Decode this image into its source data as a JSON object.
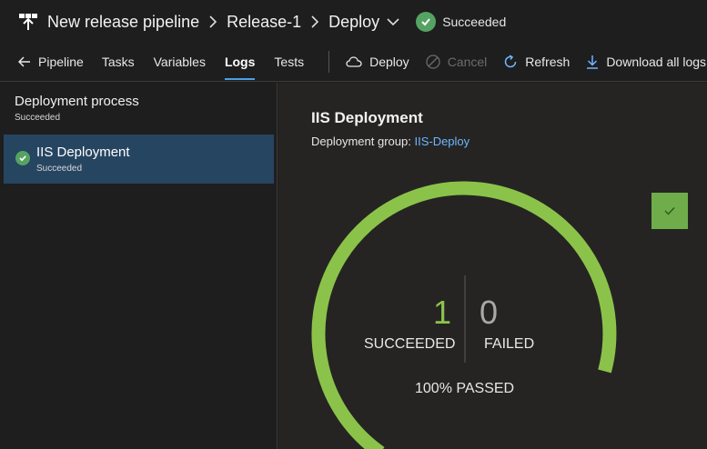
{
  "header": {
    "breadcrumbs": [
      "New release pipeline",
      "Release-1",
      "Deploy"
    ],
    "status": "Succeeded"
  },
  "toolbar": {
    "tabs": [
      "Pipeline",
      "Tasks",
      "Variables",
      "Logs",
      "Tests"
    ],
    "active_tab": "Logs",
    "actions": [
      "Deploy",
      "Cancel",
      "Refresh",
      "Download all logs"
    ]
  },
  "sidebar": {
    "process_title": "Deployment process",
    "process_status": "Succeeded",
    "stage": {
      "name": "IIS Deployment",
      "status": "Succeeded"
    }
  },
  "main": {
    "job_title": "IIS Deployment",
    "group_label": "Deployment group:",
    "group_link": "IIS-Deploy",
    "succeeded_count": "1",
    "succeeded_label": "SUCCEEDED",
    "failed_count": "0",
    "failed_label": "FAILED",
    "passed_text": "100% PASSED",
    "passed_fraction": 1.0
  },
  "colors": {
    "accent_green": "#8bc34a",
    "status_green": "#55a362",
    "link_blue": "#6eb6ff",
    "active_underline": "#4aa0e6",
    "selected_row": "#264561"
  },
  "icons": [
    "pipeline-icon",
    "chevron-right-icon",
    "chevron-down-icon",
    "check-circle-icon",
    "arrow-left-icon",
    "cloud-icon",
    "cancel-icon",
    "refresh-icon",
    "download-icon",
    "check-icon"
  ]
}
